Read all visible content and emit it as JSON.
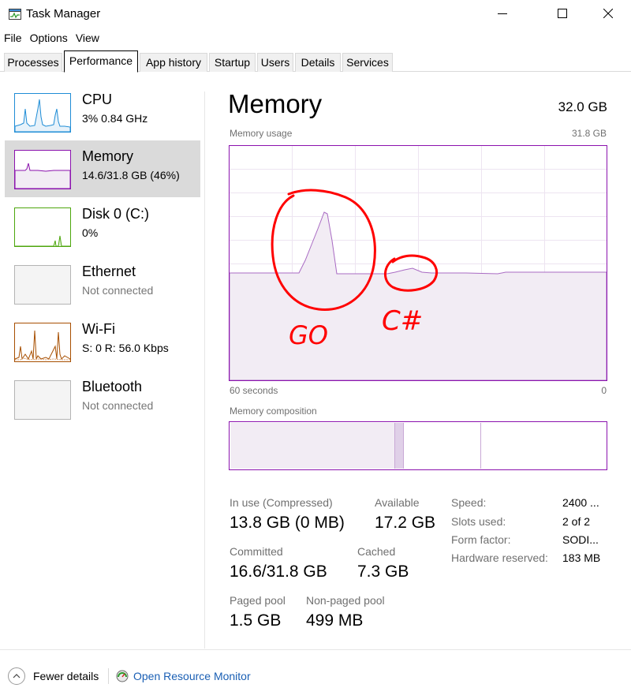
{
  "window": {
    "title": "Task Manager"
  },
  "menu": [
    "File",
    "Options",
    "View"
  ],
  "tabs": [
    "Processes",
    "Performance",
    "App history",
    "Startup",
    "Users",
    "Details",
    "Services"
  ],
  "resources": [
    {
      "name": "CPU",
      "detail": "3%  0.84 GHz",
      "color": "#1f8dd6"
    },
    {
      "name": "Memory",
      "detail": "14.6/31.8 GB (46%)",
      "color": "#8b12ae"
    },
    {
      "name": "Disk 0 (C:)",
      "detail": "0%",
      "color": "#4da60c"
    },
    {
      "name": "Ethernet",
      "detail": "Not connected",
      "color": "#a0a0a0"
    },
    {
      "name": "Wi-Fi",
      "detail": "S: 0  R: 56.0 Kbps",
      "color": "#a74f01"
    },
    {
      "name": "Bluetooth",
      "detail": "Not connected",
      "color": "#a0a0a0"
    }
  ],
  "memory": {
    "title": "Memory",
    "total": "32.0 GB",
    "usage_label": "Memory usage",
    "usage_max": "31.8 GB",
    "time_left": "60 seconds",
    "time_right": "0",
    "composition_label": "Memory composition",
    "stats": {
      "in_use_label": "In use (Compressed)",
      "in_use_value": "13.8 GB (0 MB)",
      "available_label": "Available",
      "available_value": "17.2 GB",
      "committed_label": "Committed",
      "committed_value": "16.6/31.8 GB",
      "cached_label": "Cached",
      "cached_value": "7.3 GB",
      "paged_label": "Paged pool",
      "paged_value": "1.5 GB",
      "nonpaged_label": "Non-paged pool",
      "nonpaged_value": "499 MB"
    },
    "details": [
      {
        "label": "Speed:",
        "value": "2400 ..."
      },
      {
        "label": "Slots used:",
        "value": "2 of 2"
      },
      {
        "label": "Form factor:",
        "value": "SODI..."
      },
      {
        "label": "Hardware reserved:",
        "value": "183 MB"
      }
    ]
  },
  "annotations": {
    "go": "GO",
    "csharp": "C#",
    "color": "#ff0000"
  },
  "footer": {
    "fewer_details": "Fewer details",
    "open_resource_monitor": "Open Resource Monitor"
  },
  "colors": {
    "memory_accent": "#8b12ae",
    "memory_fill": "#f2ecf4",
    "link": "#1a5fb4"
  }
}
